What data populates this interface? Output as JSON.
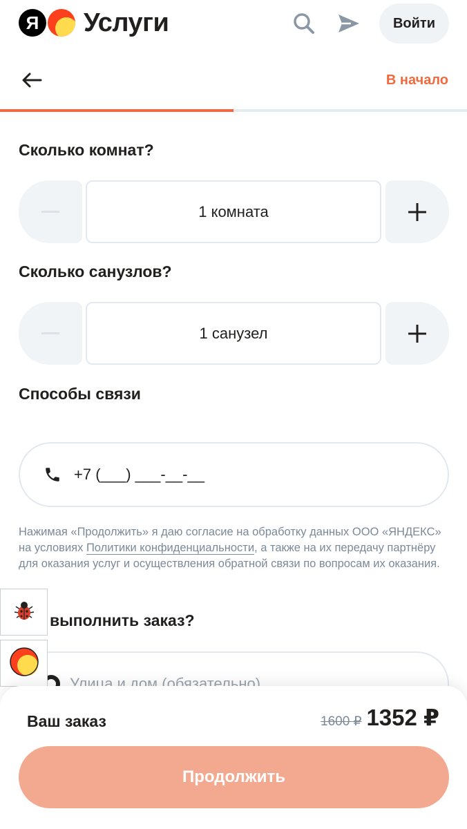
{
  "header": {
    "logo_letter": "Я",
    "logo_text": "Услуги",
    "login_label": "Войти"
  },
  "nav": {
    "to_start_label": "В начало",
    "progress_fraction": 0.5
  },
  "rooms": {
    "title": "Сколько комнат?",
    "value": "1 комната",
    "minus": "−",
    "plus": "+"
  },
  "bathrooms": {
    "title": "Сколько санузлов?",
    "value": "1 санузел",
    "minus": "−",
    "plus": "+"
  },
  "contact": {
    "title": "Способы связи",
    "phone_placeholder": "+7 (___) ___-__-__",
    "consent_text_1": "Нажимая «Продолжить» я даю согласие на обработку данных ООО «ЯНДЕКС» на условиях ",
    "consent_link": "Политики конфиденциальности",
    "consent_text_2": ", а также на их передачу партнёру для оказания услуг и осуществления обратной связи по вопросам их оказания."
  },
  "address": {
    "title": "выполнить заказ?",
    "placeholder": "Улица и дом (обязательно)"
  },
  "order": {
    "label": "Ваш заказ",
    "old_price": "1600 ₽",
    "new_price": "1352 ₽",
    "continue_label": "Продолжить"
  },
  "colors": {
    "accent": "#f06a3e",
    "button_disabled": "#f2a990",
    "muted_text": "#7b8998"
  },
  "icons": {
    "search": "search-icon",
    "send": "send-icon",
    "back": "arrow-left-icon",
    "phone": "phone-icon",
    "pin": "map-pin-icon",
    "bug": "ladybug-icon"
  }
}
